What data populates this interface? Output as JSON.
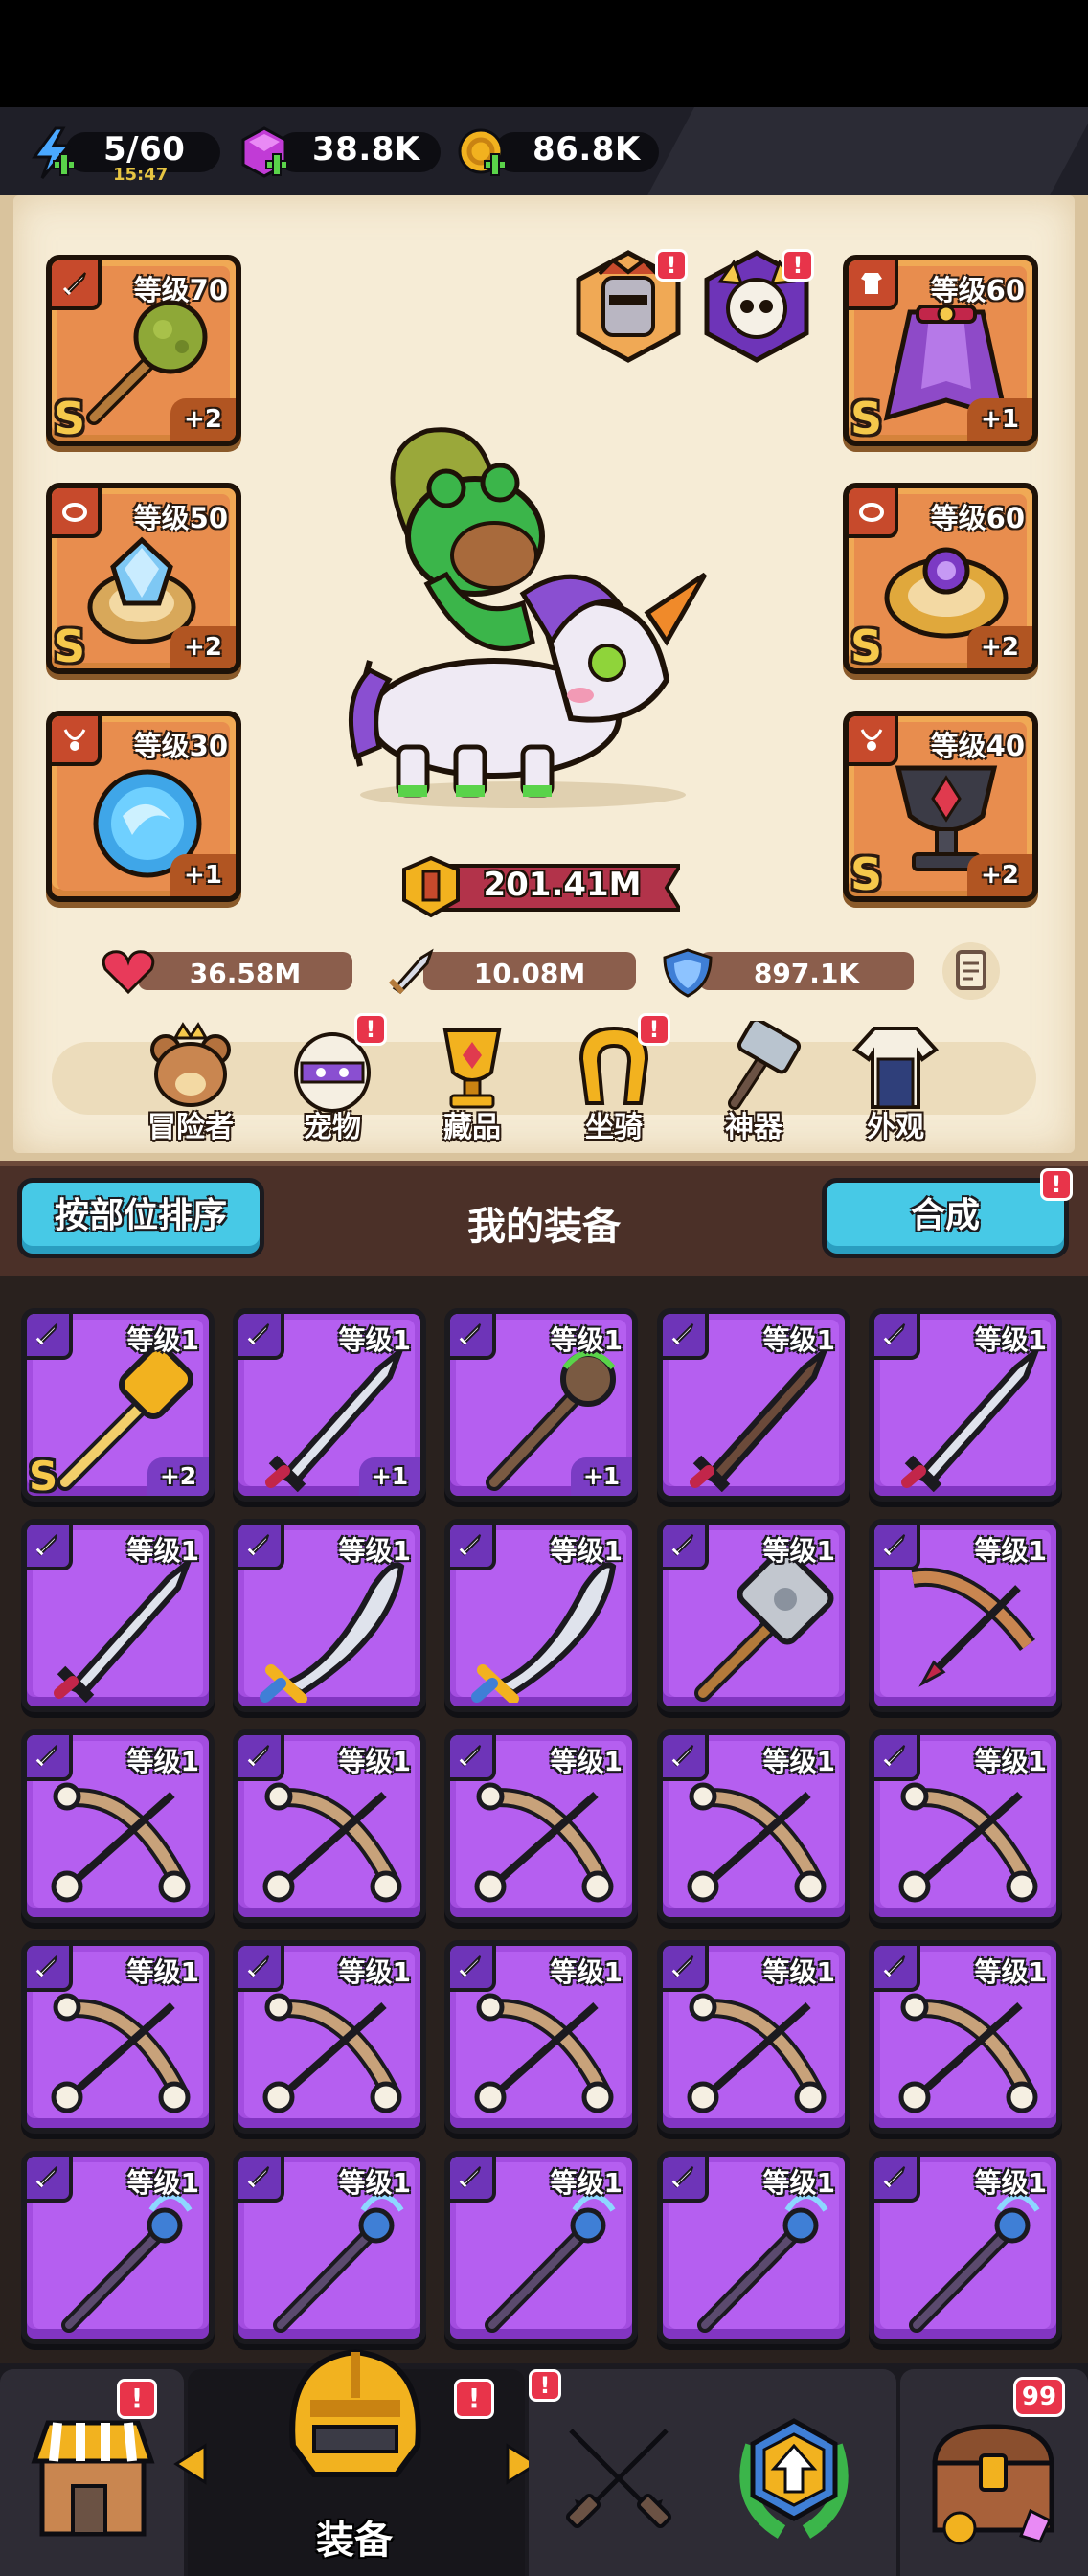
{
  "topbar": {
    "energy": {
      "value": "5/60",
      "timer": "15:47",
      "icon": "lightning-icon"
    },
    "gems": {
      "value": "38.8K",
      "icon": "gem-icon"
    },
    "coins": {
      "value": "86.8K",
      "icon": "coin-icon"
    }
  },
  "hero": {
    "equipped_left": [
      {
        "level": "等级70",
        "plus": "+2",
        "rank": "S",
        "slot": "weapon",
        "icon": "mace-icon"
      },
      {
        "level": "等级50",
        "plus": "+2",
        "rank": "S",
        "slot": "ring",
        "icon": "crystal-ring-icon"
      },
      {
        "level": "等级30",
        "plus": "+1",
        "rank": "",
        "slot": "necklace",
        "icon": "orb-icon"
      }
    ],
    "equipped_right": [
      {
        "level": "等级60",
        "plus": "+1",
        "rank": "S",
        "slot": "armor",
        "icon": "cape-icon"
      },
      {
        "level": "等级60",
        "plus": "+2",
        "rank": "S",
        "slot": "belt",
        "icon": "gold-ring-icon"
      },
      {
        "level": "等级40",
        "plus": "+2",
        "rank": "S",
        "slot": "trinket",
        "icon": "goblet-icon"
      }
    ],
    "power": "201.41M",
    "hp": "36.58M",
    "attack": "10.08M",
    "defense": "897.1K"
  },
  "categories": [
    {
      "label": "冒险者",
      "icon": "bear-icon",
      "alert": false
    },
    {
      "label": "宠物",
      "icon": "pet-egg-icon",
      "alert": true
    },
    {
      "label": "藏品",
      "icon": "trophy-icon",
      "alert": false
    },
    {
      "label": "坐骑",
      "icon": "horseshoe-icon",
      "alert": true
    },
    {
      "label": "神器",
      "icon": "hammer-icon",
      "alert": false
    },
    {
      "label": "外观",
      "icon": "outfit-icon",
      "alert": false
    }
  ],
  "equipment": {
    "sort_label": "按部位排序",
    "title": "我的装备",
    "merge_label": "合成",
    "items": [
      {
        "level": "等级1",
        "plus": "+2",
        "rank": "S",
        "icon": "golden-hammer-icon"
      },
      {
        "level": "等级1",
        "plus": "+1",
        "rank": "",
        "icon": "sword-icon"
      },
      {
        "level": "等级1",
        "plus": "+1",
        "rank": "",
        "icon": "staff-icon"
      },
      {
        "level": "等级1",
        "plus": "",
        "rank": "",
        "icon": "dark-sword-icon"
      },
      {
        "level": "等级1",
        "plus": "",
        "rank": "",
        "icon": "sword-icon"
      },
      {
        "level": "等级1",
        "plus": "",
        "rank": "",
        "icon": "sword-icon"
      },
      {
        "level": "等级1",
        "plus": "",
        "rank": "",
        "icon": "scimitar-icon"
      },
      {
        "level": "等级1",
        "plus": "",
        "rank": "",
        "icon": "scimitar-icon"
      },
      {
        "level": "等级1",
        "plus": "",
        "rank": "",
        "icon": "stone-hammer-icon"
      },
      {
        "level": "等级1",
        "plus": "",
        "rank": "",
        "icon": "crossbow-icon"
      },
      {
        "level": "等级1",
        "plus": "",
        "rank": "",
        "icon": "bone-bow-icon"
      },
      {
        "level": "等级1",
        "plus": "",
        "rank": "",
        "icon": "bone-bow-icon"
      },
      {
        "level": "等级1",
        "plus": "",
        "rank": "",
        "icon": "bone-bow-icon"
      },
      {
        "level": "等级1",
        "plus": "",
        "rank": "",
        "icon": "bone-bow-icon"
      },
      {
        "level": "等级1",
        "plus": "",
        "rank": "",
        "icon": "bone-bow-icon"
      },
      {
        "level": "等级1",
        "plus": "",
        "rank": "",
        "icon": "bone-bow-icon"
      },
      {
        "level": "等级1",
        "plus": "",
        "rank": "",
        "icon": "bone-bow-icon"
      },
      {
        "level": "等级1",
        "plus": "",
        "rank": "",
        "icon": "bone-bow-icon"
      },
      {
        "level": "等级1",
        "plus": "",
        "rank": "",
        "icon": "bone-bow-icon"
      },
      {
        "level": "等级1",
        "plus": "",
        "rank": "",
        "icon": "bone-bow-icon"
      },
      {
        "level": "等级1",
        "plus": "",
        "rank": "",
        "icon": "magic-wand-icon"
      },
      {
        "level": "等级1",
        "plus": "",
        "rank": "",
        "icon": "magic-wand-icon"
      },
      {
        "level": "等级1",
        "plus": "",
        "rank": "",
        "icon": "magic-wand-icon"
      },
      {
        "level": "等级1",
        "plus": "",
        "rank": "",
        "icon": "magic-wand-icon"
      },
      {
        "level": "等级1",
        "plus": "",
        "rank": "",
        "icon": "magic-wand-icon"
      }
    ]
  },
  "bottom_nav": {
    "active_label": "装备",
    "chest_count": "99",
    "tabs": [
      {
        "icon": "shop-icon",
        "alert": true
      },
      {
        "icon": "helmet-icon",
        "alert": true
      },
      {
        "icon": "crossed-swords-icon",
        "alert": false
      },
      {
        "icon": "upgrade-icon",
        "alert": true
      },
      {
        "icon": "treasure-chest-icon",
        "alert": false
      }
    ]
  },
  "colors": {
    "equipped_slot": "#f0a955",
    "item_card": "#a34de0",
    "accent_button": "#47c9e6",
    "alert": "#e8344a"
  }
}
